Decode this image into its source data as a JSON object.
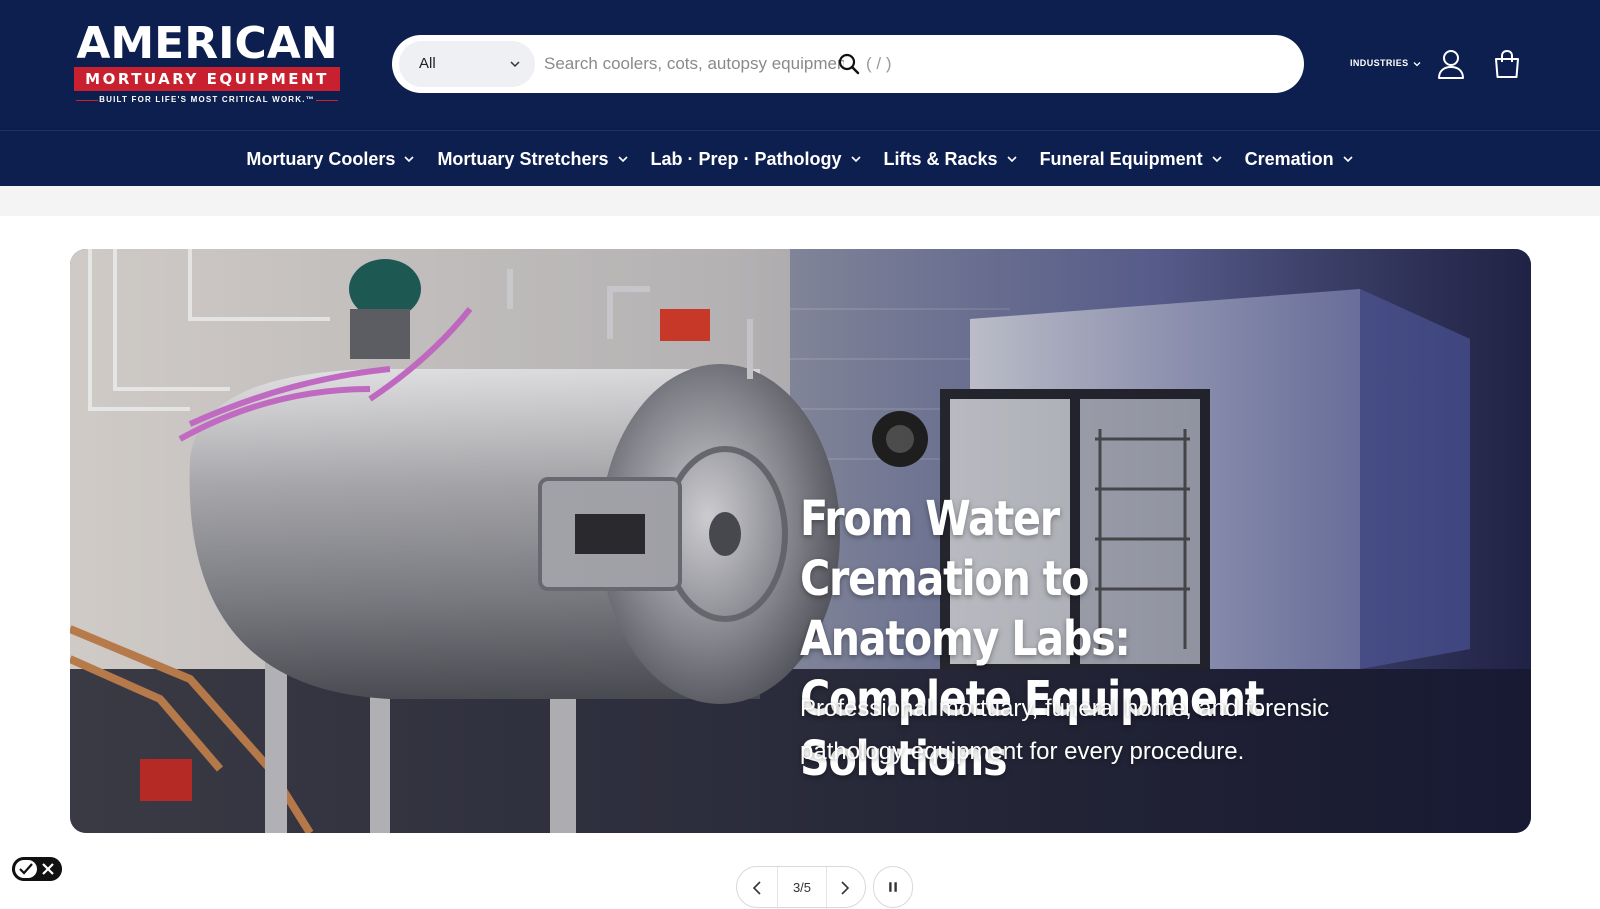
{
  "brand": {
    "name_main": "AMERICAN",
    "name_sub": "MORTUARY EQUIPMENT",
    "tagline": "BUILT FOR LIFE'S MOST CRITICAL WORK.™",
    "colors": {
      "navy": "#0c1f4f",
      "red": "#c8202f"
    }
  },
  "search": {
    "category": "All",
    "placeholder": "Search coolers, cots, autopsy equipmen",
    "shortcut_hint": "( / )"
  },
  "header": {
    "industries_label": "INDUSTRIES",
    "account_icon": "user-icon",
    "cart_icon": "shopping-bag-icon"
  },
  "nav": {
    "items": [
      {
        "label": "Mortuary Coolers"
      },
      {
        "label": "Mortuary Stretchers"
      },
      {
        "label": "Lab · Prep · Pathology"
      },
      {
        "label": "Lifts & Racks"
      },
      {
        "label": "Funeral Equipment"
      },
      {
        "label": "Cremation"
      }
    ]
  },
  "hero": {
    "title": "From Water Cremation to Anatomy Labs: Complete Equipment Solutions",
    "subtitle": "Professional mortuary, funeral home, and forensic pathology equipment for every procedure."
  },
  "slider": {
    "counter": "3/5",
    "current": 3,
    "total": 5
  }
}
